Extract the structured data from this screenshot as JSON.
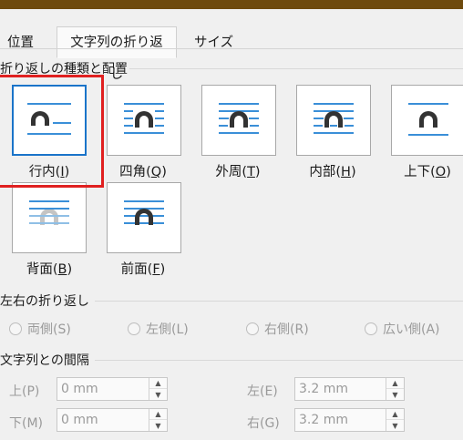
{
  "tabs": [
    {
      "label": "位置"
    },
    {
      "label": "文字列の折り返し"
    },
    {
      "label": "サイズ"
    }
  ],
  "wrap_section": {
    "title": "折り返しの種類と配置",
    "options": [
      {
        "name": "inline",
        "label": "行内(",
        "key": "I",
        "close": ")"
      },
      {
        "name": "square",
        "label": "四角(",
        "key": "Q",
        "close": ")"
      },
      {
        "name": "tight",
        "label": "外周(",
        "key": "T",
        "close": ")"
      },
      {
        "name": "through",
        "label": "内部(",
        "key": "H",
        "close": ")"
      },
      {
        "name": "top-bottom",
        "label": "上下(",
        "key": "O",
        "close": ")"
      },
      {
        "name": "behind",
        "label": "背面(",
        "key": "B",
        "close": ")"
      },
      {
        "name": "front",
        "label": "前面(",
        "key": "F",
        "close": ")"
      }
    ]
  },
  "sides_section": {
    "title": "左右の折り返し",
    "options": [
      "両側(S)",
      "左側(L)",
      "右側(R)",
      "広い側(A)"
    ]
  },
  "distance_section": {
    "title": "文字列との間隔",
    "top": {
      "label": "上(P)",
      "value": "0 mm"
    },
    "bottom": {
      "label": "下(M)",
      "value": "0 mm"
    },
    "left": {
      "label": "左(E)",
      "value": "3.2 mm"
    },
    "right": {
      "label": "右(G)",
      "value": "3.2 mm"
    }
  },
  "icons": {
    "spin_up": "▲",
    "spin_down": "▼"
  },
  "colors": {
    "accent": "#1a74c9",
    "text_line": "#3a8fd8",
    "shape": "#333333",
    "highlight": "#e02020"
  }
}
